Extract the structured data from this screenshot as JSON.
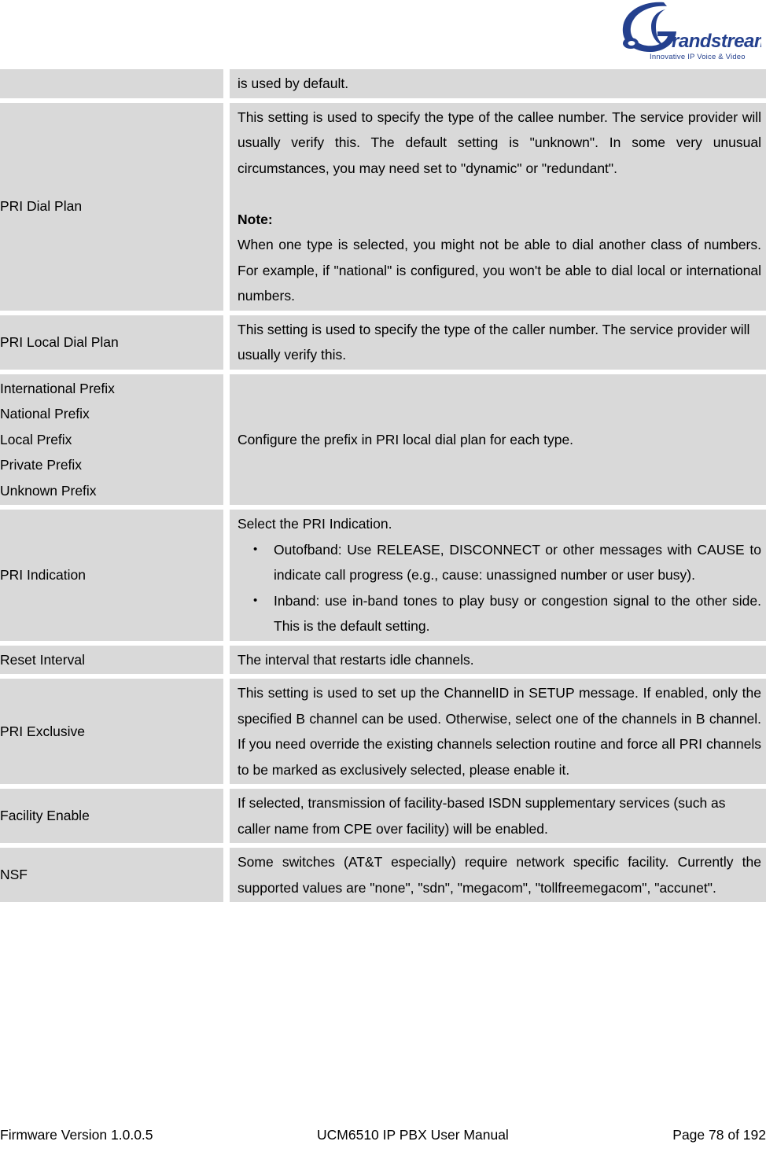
{
  "header": {
    "logo_name": "Grandstream",
    "logo_tagline": "Innovative IP Voice & Video"
  },
  "table": {
    "rows": [
      {
        "label": "",
        "desc_blocks": [
          {
            "type": "p",
            "text": "is used by default."
          }
        ]
      },
      {
        "label": "PRI Dial Plan",
        "desc_blocks": [
          {
            "type": "p",
            "text": "This setting is used to specify the type of the callee number. The service provider will usually verify this. The default setting is \"unknown\". In some very unusual circumstances, you may need set to \"dynamic\" or \"redundant\"."
          },
          {
            "type": "spacer",
            "text": ""
          },
          {
            "type": "note",
            "text": "Note:"
          },
          {
            "type": "p",
            "text": "When one type is selected, you might not be able to dial another class of numbers. For example, if \"national\" is configured, you won't be able to dial local or international numbers."
          }
        ]
      },
      {
        "label": "PRI Local Dial Plan",
        "desc_blocks": [
          {
            "type": "p",
            "text": "This setting is used to specify the type of the caller number. The service provider will usually verify this."
          }
        ]
      },
      {
        "label_lines": [
          "International Prefix",
          "National Prefix",
          "Local Prefix",
          "Private Prefix",
          "Unknown Prefix"
        ],
        "desc_blocks": [
          {
            "type": "p",
            "text": "Configure the prefix in PRI local dial plan for each type."
          }
        ]
      },
      {
        "label": "PRI Indication",
        "desc_blocks": [
          {
            "type": "p",
            "text": "Select the PRI Indication."
          },
          {
            "type": "bullets",
            "items": [
              "Outofband: Use RELEASE, DISCONNECT or other messages with CAUSE to indicate call progress (e.g., cause: unassigned number or user busy).",
              "Inband: use in-band tones to play busy or congestion signal to the other side. This is the default setting."
            ]
          }
        ]
      },
      {
        "label": "Reset Interval",
        "desc_blocks": [
          {
            "type": "p",
            "text": "The interval that restarts idle channels."
          }
        ]
      },
      {
        "label": "PRI Exclusive",
        "desc_blocks": [
          {
            "type": "p",
            "text": "This setting is used to set up the ChannelID in SETUP message. If enabled, only the specified B channel can be used. Otherwise, select one of the channels in B channel. If you need override the existing channels selection routine and force all PRI channels to be marked as exclusively selected, please enable it."
          }
        ]
      },
      {
        "label": "Facility Enable",
        "desc_blocks": [
          {
            "type": "p",
            "text": "If selected, transmission of facility-based ISDN supplementary services (such as caller name from CPE over facility) will be enabled."
          }
        ]
      },
      {
        "label": "NSF",
        "desc_blocks": [
          {
            "type": "p",
            "text": "Some switches (AT&T especially) require network specific facility. Currently the supported values are \"none\", \"sdn\", \"megacom\", \"tollfreemegacom\", \"accunet\"."
          }
        ]
      }
    ]
  },
  "footer": {
    "firmware": "Firmware Version 1.0.0.5",
    "manual": "UCM6510 IP PBX User Manual",
    "page": "Page 78 of 192"
  },
  "colors": {
    "cell_bg": "#D9D9D9",
    "page_bg": "#FFFFFF",
    "logo_blue": "#1F3C8C",
    "text": "#000000"
  }
}
